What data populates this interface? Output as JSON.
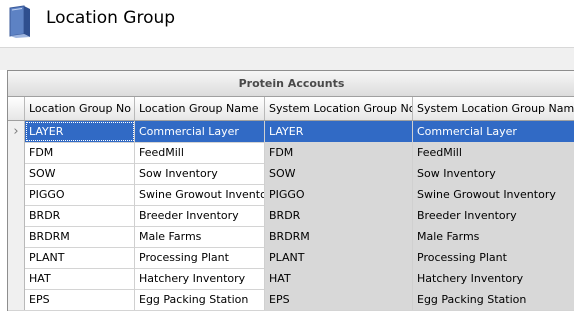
{
  "header": {
    "title": "Location Group"
  },
  "grid": {
    "caption": "Protein Accounts",
    "columns": [
      "Location Group No",
      "Location Group Name",
      "System Location Group No",
      "System Location Group Name"
    ],
    "rows": [
      [
        "LAYER",
        "Commercial Layer",
        "LAYER",
        "Commercial Layer"
      ],
      [
        "FDM",
        "FeedMill",
        "FDM",
        "FeedMill"
      ],
      [
        "SOW",
        "Sow Inventory",
        "SOW",
        "Sow Inventory"
      ],
      [
        "PIGGO",
        "Swine Growout Inventory",
        "PIGGO",
        "Swine Growout Inventory"
      ],
      [
        "BRDR",
        "Breeder Inventory",
        "BRDR",
        "Breeder Inventory"
      ],
      [
        "BRDRM",
        "Male Farms",
        "BRDRM",
        "Male Farms"
      ],
      [
        "PLANT",
        "Processing Plant",
        "PLANT",
        "Processing Plant"
      ],
      [
        "HAT",
        "Hatchery Inventory",
        "HAT",
        "Hatchery Inventory"
      ],
      [
        "EPS",
        "Egg Packing Station",
        "EPS",
        "Egg Packing Station"
      ]
    ],
    "selected_row": 0,
    "row_indicator_icon": "chevron-right-icon"
  },
  "colors": {
    "selection": "#316ac5",
    "system_columns": "#d8d8d8"
  }
}
